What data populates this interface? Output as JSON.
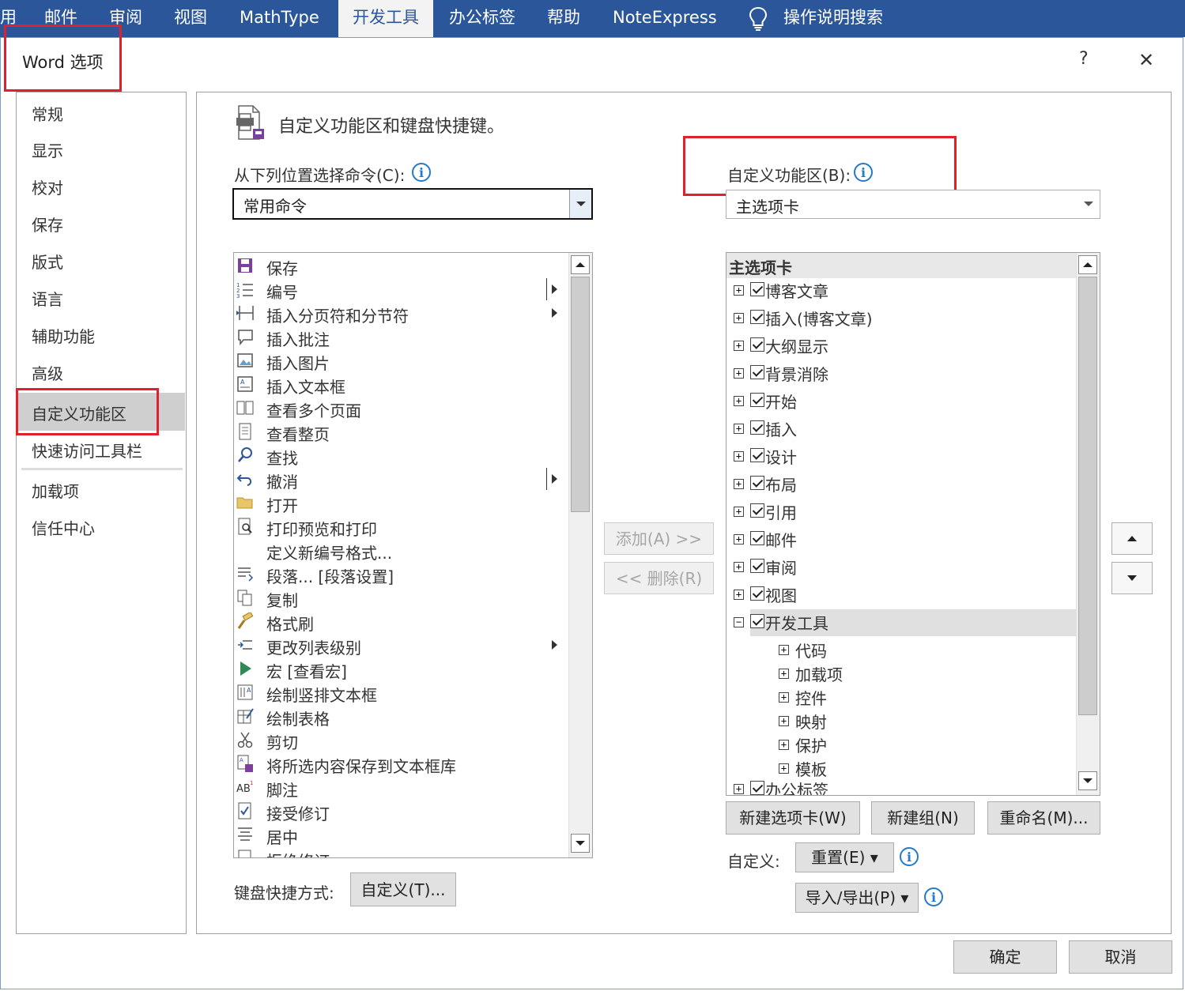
{
  "ribbon": {
    "tabs": [
      "用",
      "邮件",
      "审阅",
      "视图",
      "MathType",
      "开发工具",
      "办公标签",
      "帮助",
      "NoteExpress"
    ],
    "active_tab": "开发工具",
    "search_label": "操作说明搜索",
    "color": "#2b579a"
  },
  "dialog": {
    "title": "Word 选项",
    "help_label": "?",
    "close_label": "✕"
  },
  "nav": {
    "items": [
      "常规",
      "显示",
      "校对",
      "保存",
      "版式",
      "语言",
      "辅助功能",
      "高级",
      "自定义功能区",
      "快速访问工具栏",
      "加载项",
      "信任中心"
    ],
    "selected": "自定义功能区"
  },
  "main": {
    "heading": "自定义功能区和键盘快捷键。",
    "choose_label": "从下列位置选择命令(C):",
    "choose_value": "常用命令",
    "customize_label": "自定义功能区(B):",
    "customize_value": "主选项卡",
    "commands": [
      {
        "label": "保存",
        "icon": "save-icon"
      },
      {
        "label": "编号",
        "icon": "numbering-icon"
      },
      {
        "label": "插入分页符和分节符",
        "icon": "page-break-icon"
      },
      {
        "label": "插入批注",
        "icon": "comment-icon"
      },
      {
        "label": "插入图片",
        "icon": "picture-icon"
      },
      {
        "label": "插入文本框",
        "icon": "textbox-icon"
      },
      {
        "label": "查看多个页面",
        "icon": "multi-page-icon"
      },
      {
        "label": "查看整页",
        "icon": "one-page-icon"
      },
      {
        "label": "查找",
        "icon": "find-icon"
      },
      {
        "label": "撤消",
        "icon": "undo-icon"
      },
      {
        "label": "打开",
        "icon": "open-folder-icon"
      },
      {
        "label": "打印预览和打印",
        "icon": "print-preview-icon"
      },
      {
        "label": "定义新编号格式...",
        "icon": ""
      },
      {
        "label": "段落... [段落设置]",
        "icon": "paragraph-icon"
      },
      {
        "label": "复制",
        "icon": "copy-icon"
      },
      {
        "label": "格式刷",
        "icon": "format-painter-icon"
      },
      {
        "label": "更改列表级别",
        "icon": "list-level-icon"
      },
      {
        "label": "宏 [查看宏]",
        "icon": "macro-icon"
      },
      {
        "label": "绘制竖排文本框",
        "icon": "vertical-textbox-icon"
      },
      {
        "label": "绘制表格",
        "icon": "draw-table-icon"
      },
      {
        "label": "剪切",
        "icon": "scissors-icon"
      },
      {
        "label": "将所选内容保存到文本框库",
        "icon": "save-to-gallery-icon"
      },
      {
        "label": "脚注",
        "icon": "footnote-icon"
      },
      {
        "label": "接受修订",
        "icon": "accept-revision-icon"
      },
      {
        "label": "居中",
        "icon": "center-align-icon"
      },
      {
        "label": "拒绝修订",
        "icon": "reject-revision-icon"
      }
    ],
    "tree_header": "主选项卡",
    "tree": [
      "博客文章",
      "插入(博客文章)",
      "大纲显示",
      "背景消除",
      "开始",
      "插入",
      "设计",
      "布局",
      "引用",
      "邮件",
      "审阅",
      "视图",
      "开发工具"
    ],
    "tree_children": [
      "代码",
      "加载项",
      "控件",
      "映射",
      "保护",
      "模板"
    ],
    "tree_last": "办公标签",
    "add_button": "添加(A) >>",
    "remove_button": "<< 删除(R)",
    "new_tab_button": "新建选项卡(W)",
    "new_group_button": "新建组(N)",
    "rename_button": "重命名(M)...",
    "customize_label2": "自定义:",
    "reset_button": "重置(E) ▾",
    "import_export_button": "导入/导出(P) ▾",
    "keyboard_label": "键盘快捷方式:",
    "keyboard_button": "自定义(T)..."
  },
  "footer": {
    "ok": "确定",
    "cancel": "取消"
  },
  "colors": {
    "highlight_red": "#e0202a",
    "info_blue": "#2479c8"
  }
}
